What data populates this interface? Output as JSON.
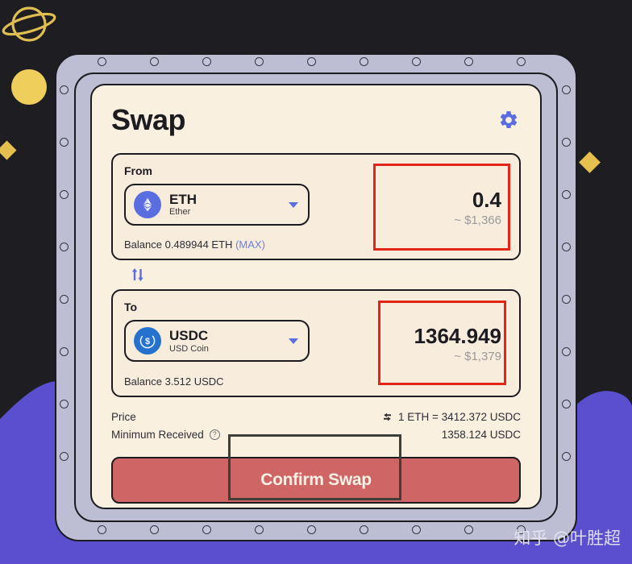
{
  "app": {
    "title": "Swap",
    "settings_icon": "gear-icon"
  },
  "from": {
    "label": "From",
    "token_symbol": "ETH",
    "token_name": "Ether",
    "token_icon": "ethereum-icon",
    "amount": "0.4",
    "amount_usd": "~ $1,366",
    "balance_text": "Balance 0.489944 ETH",
    "max_label": "(MAX)"
  },
  "swap_direction": {
    "icon": "swap-vertical-icon"
  },
  "to": {
    "label": "To",
    "token_symbol": "USDC",
    "token_name": "USD Coin",
    "token_icon": "usdc-icon",
    "amount": "1364.949",
    "amount_usd": "~ $1,379",
    "balance_text": "Balance 3.512 USDC"
  },
  "details": {
    "price_label": "Price",
    "price_value": "1 ETH = 3412.372 USDC",
    "price_swap_icon": "swap-horizontal-icon",
    "minimum_label": "Minimum Received",
    "minimum_help_icon": "help-circle-icon",
    "minimum_value": "1358.124 USDC"
  },
  "actions": {
    "confirm_label": "Confirm Swap"
  },
  "watermark": {
    "text": "知乎 @叶胜超"
  },
  "decorations": {
    "planet": "saturn-icon",
    "circle": "yellow-circle",
    "diamond_left": "yellow-diamond",
    "diamond_right": "yellow-diamond"
  },
  "colors": {
    "background": "#1e1e22",
    "purple_wave": "#5a4fcf",
    "bezel": "#bdbed4",
    "card": "#faf0e0",
    "accent_blue": "#5b6ee1",
    "confirm_red": "#d06565",
    "highlight_red": "#e32418",
    "decor_yellow": "#e5c04f"
  }
}
